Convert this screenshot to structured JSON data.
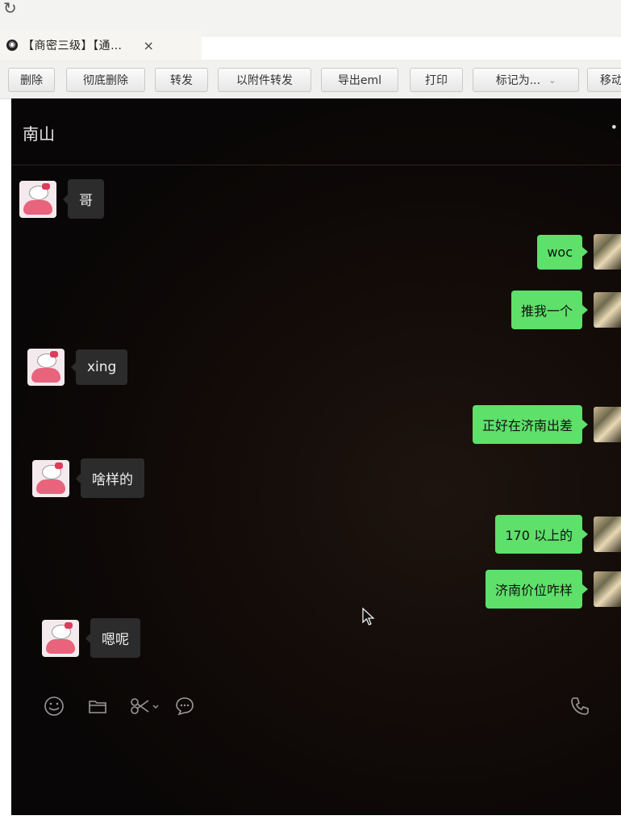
{
  "browser": {
    "tab_title": "【商密三级】【通…",
    "tab_close": "×",
    "favicon": "tab-favicon-icon"
  },
  "toolbar": {
    "buttons": [
      "删除",
      "彻底删除",
      "转发",
      "以附件转发",
      "导出eml",
      "打印",
      "标记为...",
      "移动"
    ]
  },
  "chat": {
    "title": "南山",
    "messages": [
      {
        "side": "in",
        "text": "哥"
      },
      {
        "side": "out",
        "text": "woc"
      },
      {
        "side": "out",
        "text": "推我一个"
      },
      {
        "side": "in",
        "text": "xing"
      },
      {
        "side": "out",
        "text": "正好在济南出差"
      },
      {
        "side": "in",
        "text": "啥样的"
      },
      {
        "side": "out",
        "text": "170 以上的"
      },
      {
        "side": "out",
        "text": "济南价位咋样"
      },
      {
        "side": "in",
        "text": "嗯呢"
      }
    ]
  },
  "composer": {
    "icons": [
      "emoji-icon",
      "folder-icon",
      "scissors-icon",
      "chat-bubble-icon",
      "phone-icon"
    ]
  },
  "colors": {
    "bubble_out": "#5ee06a",
    "bubble_in": "#2c2c2c",
    "chat_bg": "#0b0807"
  }
}
